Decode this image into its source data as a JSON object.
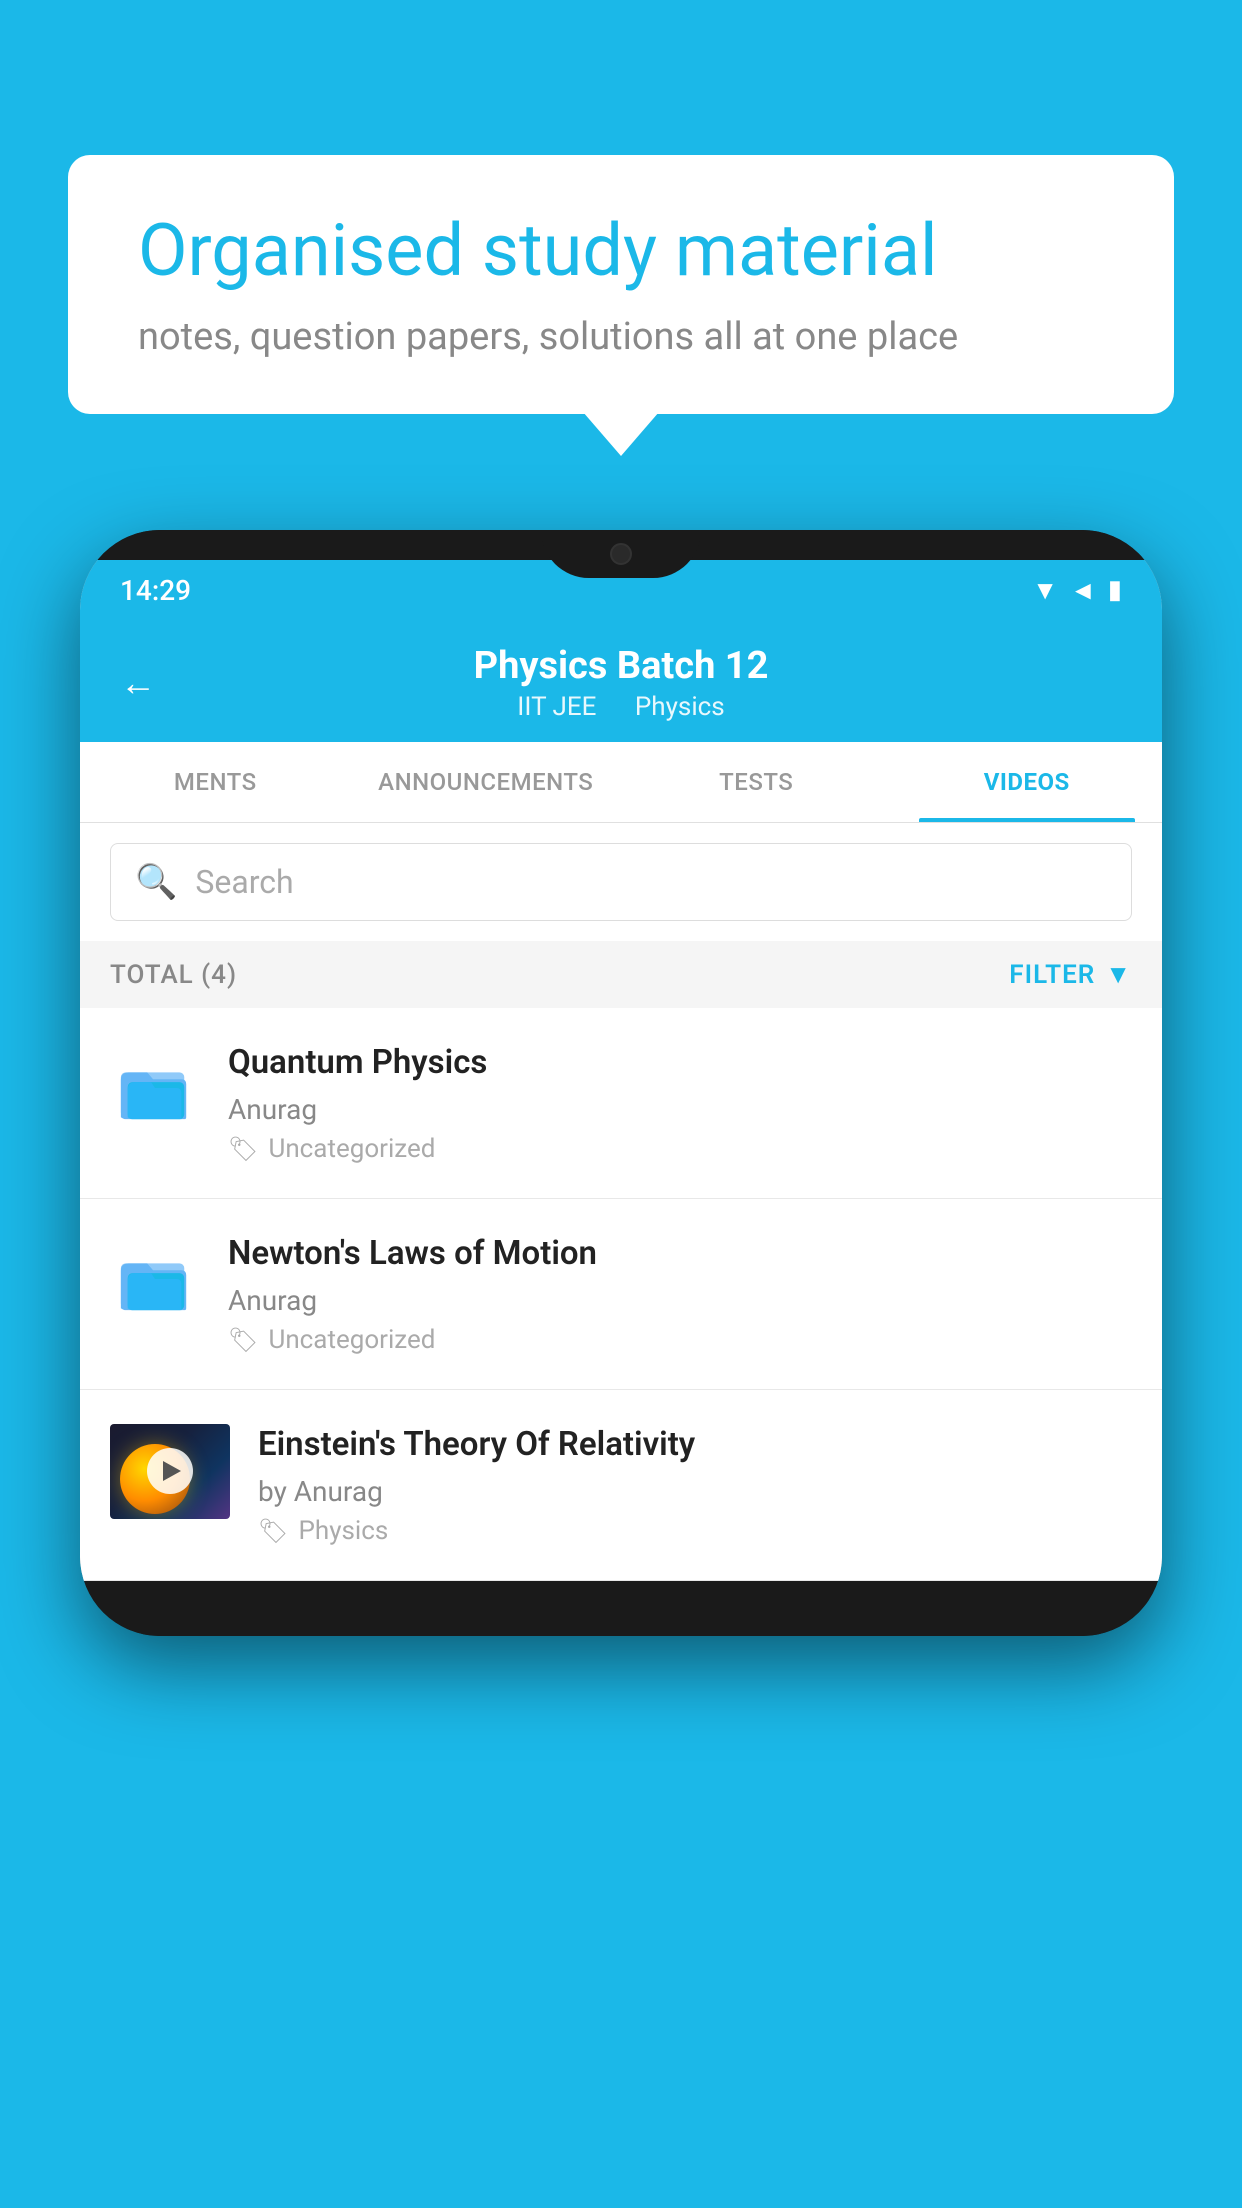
{
  "background_color": "#1BB8E8",
  "speech_bubble": {
    "title": "Organised study material",
    "subtitle": "notes, question papers, solutions all at one place"
  },
  "phone": {
    "status_bar": {
      "time": "14:29"
    },
    "header": {
      "title": "Physics Batch 12",
      "subtitle_part1": "IIT JEE",
      "subtitle_part2": "Physics"
    },
    "tabs": [
      {
        "label": "MENTS",
        "active": false
      },
      {
        "label": "ANNOUNCEMENTS",
        "active": false
      },
      {
        "label": "TESTS",
        "active": false
      },
      {
        "label": "VIDEOS",
        "active": true
      }
    ],
    "search": {
      "placeholder": "Search"
    },
    "filter": {
      "total_label": "TOTAL (4)",
      "filter_label": "FILTER"
    },
    "videos": [
      {
        "id": 1,
        "title": "Quantum Physics",
        "author": "Anurag",
        "tag": "Uncategorized",
        "has_thumbnail": false
      },
      {
        "id": 2,
        "title": "Newton's Laws of Motion",
        "author": "Anurag",
        "tag": "Uncategorized",
        "has_thumbnail": false
      },
      {
        "id": 3,
        "title": "Einstein's Theory Of Relativity",
        "author": "by Anurag",
        "tag": "Physics",
        "has_thumbnail": true
      }
    ]
  }
}
